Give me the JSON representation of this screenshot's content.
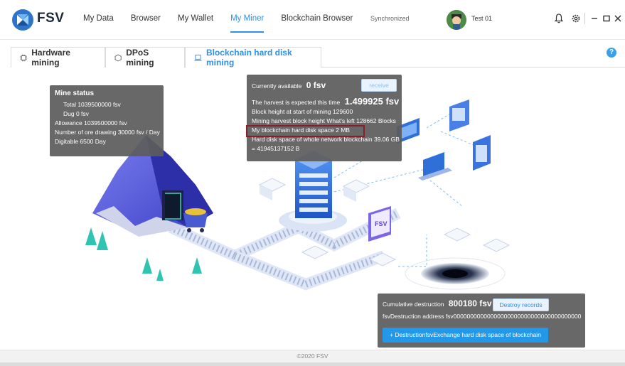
{
  "app": {
    "brand": "FSV"
  },
  "nav": {
    "items": [
      "My Data",
      "Browser",
      "My Wallet",
      "My Miner",
      "Blockchain Browser"
    ],
    "active": "My Miner"
  },
  "status": {
    "sync": "Synchronized"
  },
  "user": {
    "name": "Test 01"
  },
  "tabs": [
    {
      "label": "Hardware mining",
      "icon": "chip-icon"
    },
    {
      "label": "DPoS mining",
      "icon": "hexagon-icon"
    },
    {
      "label": "Blockchain hard disk mining",
      "icon": "laptop-icon",
      "active": true
    }
  ],
  "mine_status": {
    "title": "Mine status",
    "total": "Total  1039500000 fsv",
    "dug": "Dug  0 fsv",
    "allowance": "Allowance  1039500000 fsv",
    "ore_drawing": "Number of ore drawing  30000 fsv / Day",
    "digitable": "Digitable  6500 Day"
  },
  "availability": {
    "label": "Currently available",
    "value": "0 fsv",
    "receive": "receive",
    "harvest_label": "The harvest is expected this time",
    "harvest_value": "1.499925 fsv",
    "block_start": "Block height at start of mining  129600",
    "block_harvest": "Mining harvest block height  What's left 128662 Blocks",
    "my_disk": "My blockchain hard disk space  2 MB",
    "network_disk_1": "Hard disk space of whole network blockchain  39.06 GB",
    "network_disk_2": "= 41945137152 B"
  },
  "destruction": {
    "label": "Cumulative destruction",
    "value": "800180 fsv",
    "records": "Destroy records",
    "address": "fsvDestruction address  fsv00000000000000000000000000000000000000",
    "exchange": "+ DestructionfsvExchange hard disk space of blockchain"
  },
  "footer": {
    "text": "©2020 FSV"
  },
  "colors": {
    "accent": "#2f8fe9",
    "panel": "#5c5c5c",
    "highlight": "#8b1c2a"
  }
}
